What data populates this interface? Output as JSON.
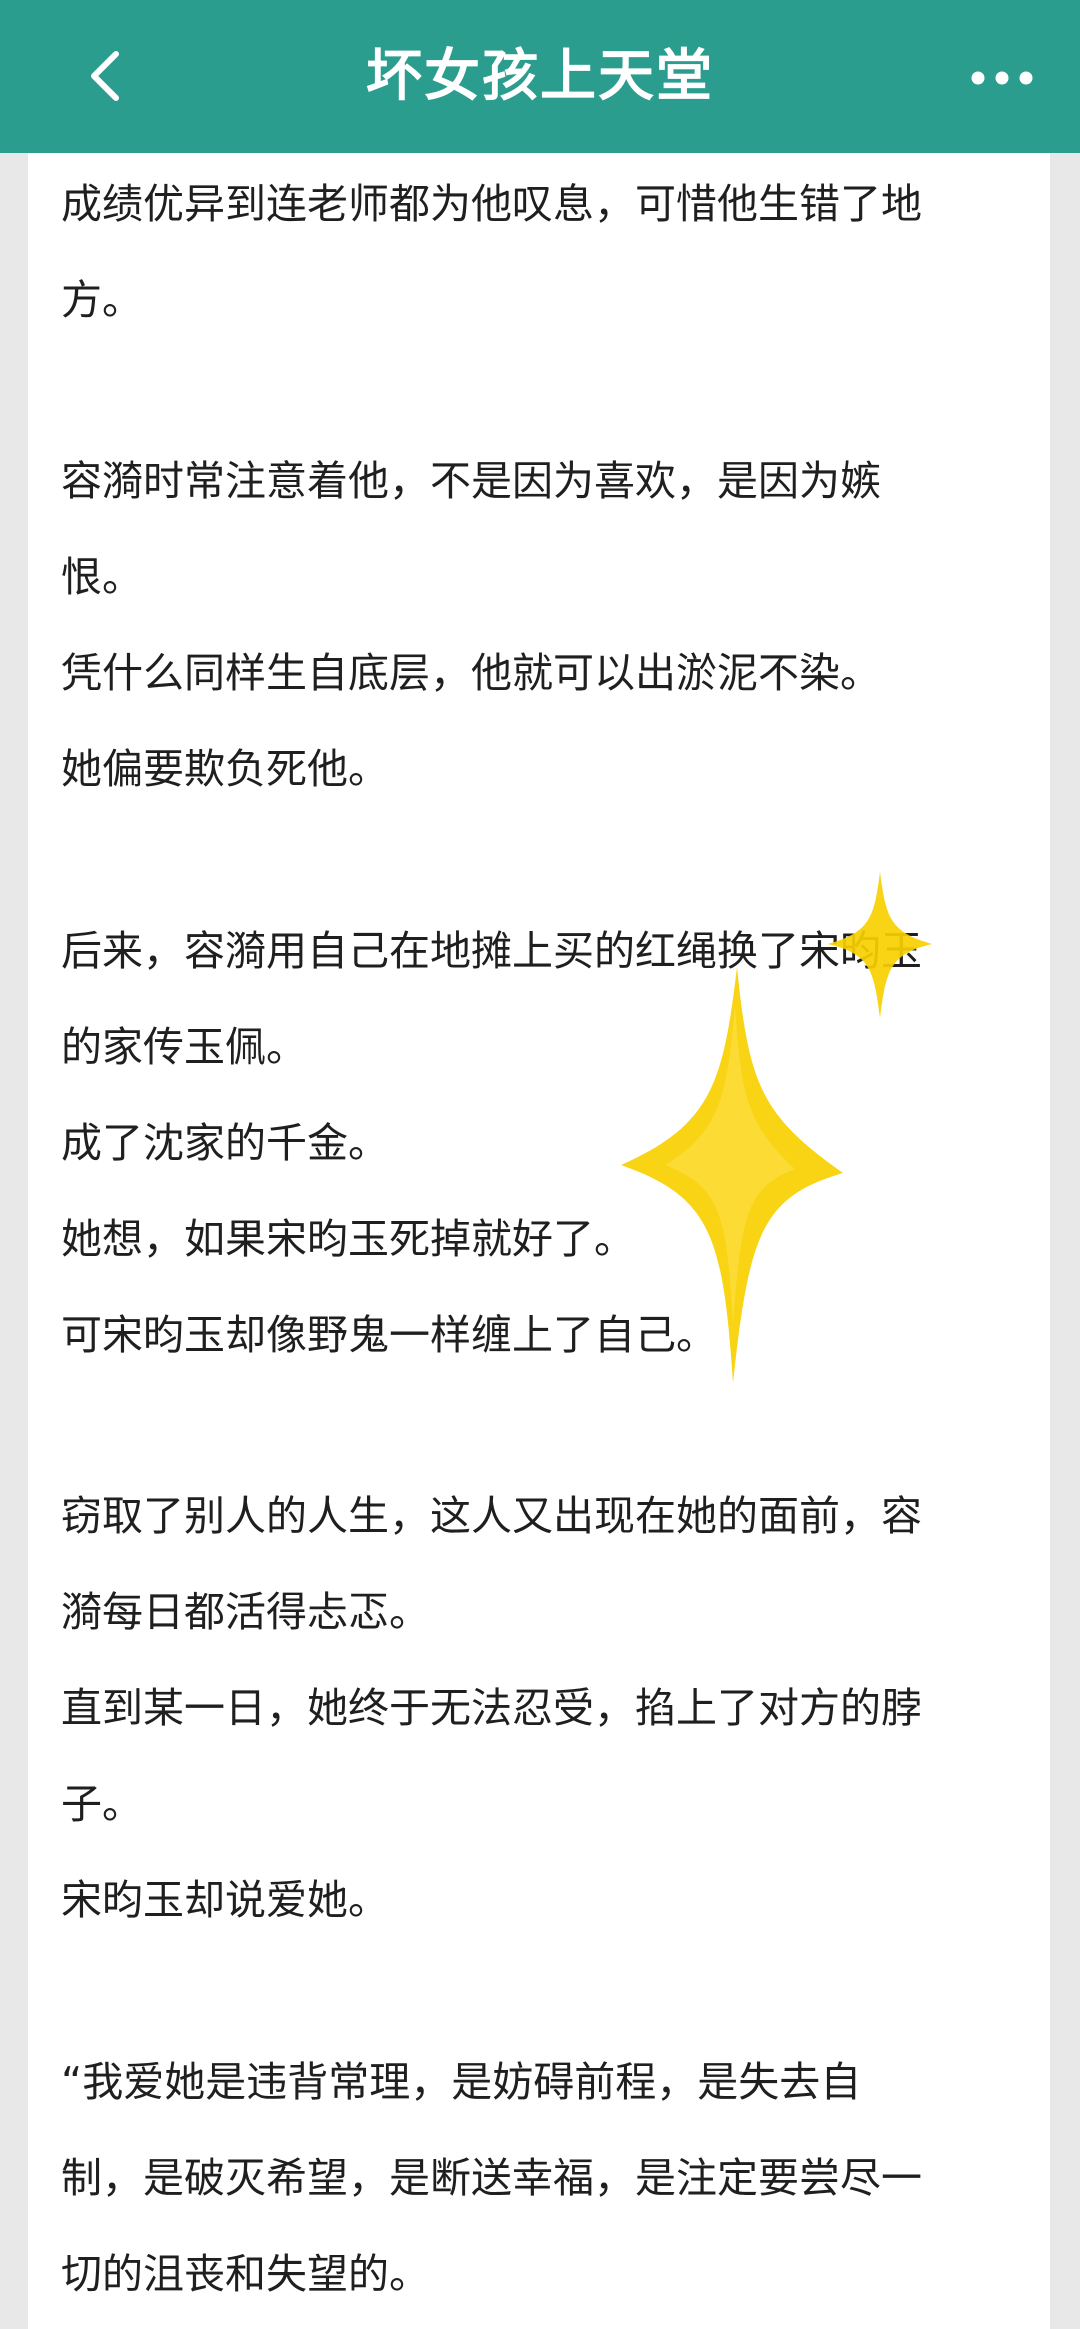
{
  "header": {
    "title": "坏女孩上天堂",
    "back_icon": "chevron-left-icon",
    "more_icon": "more-horizontal-icon",
    "bg_color": "#2a9d8f"
  },
  "content": {
    "lines": [
      "成绩优异到连老师都为他叹息，可惜他生错了地",
      "方。",
      "容漪时常注意着他，不是因为喜欢，是因为嫉",
      "恨。",
      "凭什么同样生自底层，他就可以出淤泥不染。",
      "她偏要欺负死他。",
      "后来，容漪用自己在地摊上买的红绳换了宋昀玉",
      "的家传玉佩。",
      "成了沈家的千金。",
      "她想，如果宋昀玉死掉就好了。",
      "可宋昀玉却像野鬼一样缠上了自己。",
      "窃取了别人的人生，这人又出现在她的面前，容",
      "漪每日都活得忐忑。",
      "直到某一日，她终于无法忍受，掐上了对方的脖",
      "子。",
      "宋昀玉却说爱她。",
      "“我爱她是违背常理，是妨碍前程，是失去自",
      "制，是破灭希望，是断送幸福，是注定要尝尽一",
      "切的沮丧和失望的。"
    ]
  },
  "decorations": {
    "sparkle_icon": "sparkle-icon",
    "sparkle_color": "#f7d000"
  }
}
